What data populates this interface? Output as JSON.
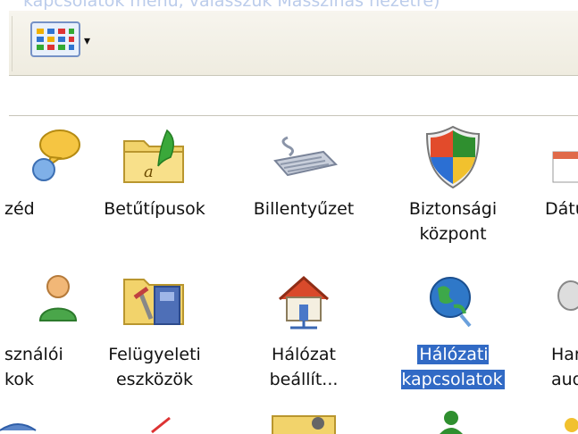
{
  "caption_text": "kapcsolatok menü, válasszuk Másszinás nézetre)",
  "toolbar": {
    "view_button": "views-menu",
    "caret": "▾"
  },
  "items": [
    {
      "label": "zéd",
      "icon": "speech-bubble-person-icon"
    },
    {
      "label": "Betűtípusok",
      "icon": "fonts-folder-icon"
    },
    {
      "label": "Billentyűzet",
      "icon": "keyboard-icon"
    },
    {
      "label": "Biztonsági\nközpont",
      "icon": "security-shield-icon"
    },
    {
      "label": "Dátu",
      "icon": "calendar-icon"
    },
    {
      "label": "sználói\nkok",
      "icon": "user-accounts-icon"
    },
    {
      "label": "Felügyeleti\neszközök",
      "icon": "admin-tools-icon"
    },
    {
      "label": "Hálózat\nbeállít...",
      "icon": "network-setup-house-icon"
    },
    {
      "label": "Hálózati\nkapcsolatok",
      "icon": "network-connections-globe-icon",
      "selected": true
    },
    {
      "label": "Har\naudio",
      "icon": "speaker-icon"
    }
  ],
  "colors": {
    "selection": "#316ac5",
    "toolbar": "#efece0"
  }
}
